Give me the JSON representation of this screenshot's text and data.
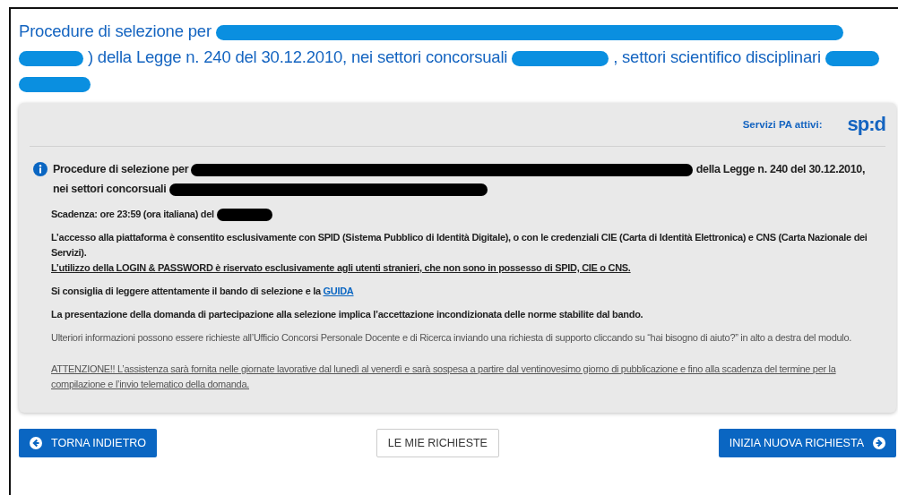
{
  "title": {
    "parts": [
      {
        "kind": "text",
        "text": "Procedure di selezione per"
      },
      {
        "kind": "redacted"
      },
      {
        "kind": "redacted"
      },
      {
        "kind": "text",
        "text": ") della Legge n. 240 del 30.12.2010, nei settori concorsuali"
      },
      {
        "kind": "redacted"
      },
      {
        "kind": "text",
        "text": ", settori scientifico disciplinari"
      },
      {
        "kind": "redacted"
      },
      {
        "kind": "redacted"
      }
    ]
  },
  "card": {
    "services_label": "Servizi PA attivi:",
    "logo": "sp:d",
    "paragraphs": [
      {
        "kind": "notice",
        "bold": true,
        "underline": false,
        "parts": [
          {
            "kind": "text",
            "text": "Procedure di selezione per"
          },
          {
            "kind": "redacted"
          },
          {
            "kind": "text",
            "text": "della Legge n. 240 del 30.12.2010,"
          },
          {
            "kind": "text",
            "text": "nei settori concorsuali"
          },
          {
            "kind": "redacted"
          }
        ]
      },
      {
        "kind": "deadline",
        "bold": true,
        "underline": false,
        "parts": [
          {
            "kind": "text",
            "text": "Scadenza: ore 23:59 (ora italiana) del"
          },
          {
            "kind": "redacted"
          }
        ]
      },
      {
        "kind": "paragraph",
        "bold": true,
        "underline": false,
        "parts": [
          {
            "kind": "text",
            "text": "L’accesso alla piattaforma è consentito esclusivamente con SPID (Sistema Pubblico di Identità Digitale), o con le credenziali CIE (Carta di Identità Elettronica) e CNS (Carta Nazionale dei Servizi)."
          }
        ]
      },
      {
        "kind": "continuation",
        "bold": true,
        "underline": true,
        "parts": [
          {
            "kind": "text",
            "text": "L’utilizzo della LOGIN & PASSWORD è riservato esclusivamente agli utenti stranieri, che non sono in possesso di SPID, CIE o CNS."
          }
        ]
      },
      {
        "kind": "paragraph",
        "bold": true,
        "underline": false,
        "parts": [
          {
            "kind": "text",
            "text": "Si consiglia di leggere attentamente il bando di selezione e la"
          },
          {
            "kind": "link",
            "text": "GUIDA"
          }
        ]
      },
      {
        "kind": "paragraph",
        "bold": true,
        "underline": false,
        "parts": [
          {
            "kind": "text",
            "text": "La presentazione della domanda di partecipazione alla selezione implica l’accettazione incondizionata delle norme stabilite dal bando."
          }
        ]
      },
      {
        "kind": "paragraph",
        "bold": false,
        "underline": false,
        "parts": [
          {
            "kind": "text",
            "text": "Ulteriori informazioni possono essere richieste all’Ufficio Concorsi Personale Docente e di Ricerca inviando una richiesta di supporto cliccando su “hai bisogno di aiuto?” in alto a destra del modulo."
          }
        ]
      },
      {
        "kind": "warning",
        "bold": false,
        "underline": true,
        "parts": [
          {
            "kind": "text",
            "text": "ATTENZIONE!! L’assistenza sarà fornita nelle giornate lavorative dal lunedì al venerdì e sarà sospesa a partire dal ventinovesimo giorno di pubblicazione e fino alla scadenza del termine per la compilazione e l’invio telematico della domanda."
          }
        ]
      }
    ]
  },
  "buttons": [
    {
      "kind": "back",
      "label": "TORNA INDIETRO"
    },
    {
      "kind": "secondary",
      "label": "LE MIE RICHIESTE"
    },
    {
      "kind": "forward",
      "label": "INIZIA NUOVA RICHIESTA"
    }
  ]
}
